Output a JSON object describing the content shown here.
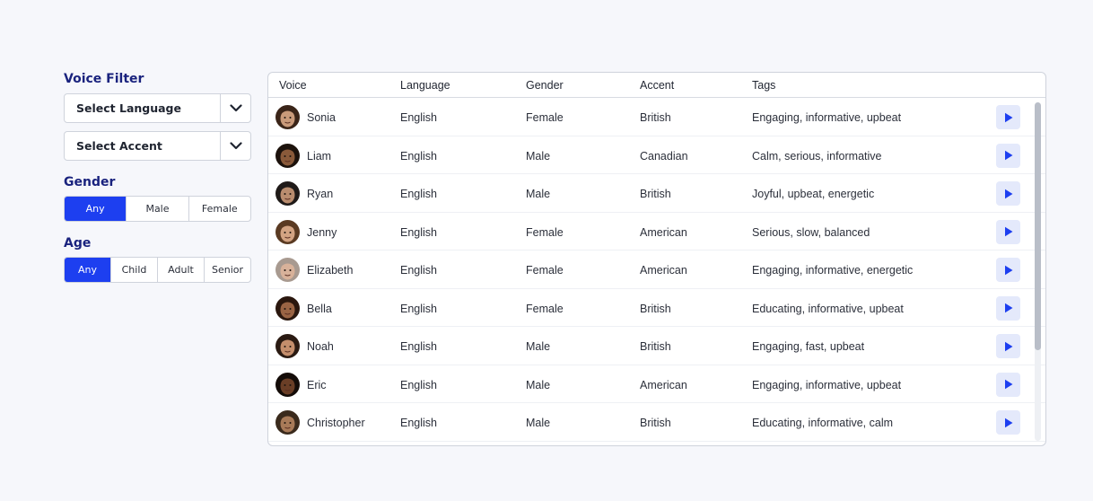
{
  "filters": {
    "voice_title": "Voice Filter",
    "language_select": "Select Language",
    "accent_select": "Select Accent",
    "gender_title": "Gender",
    "gender_options": [
      "Any",
      "Male",
      "Female"
    ],
    "gender_selected": "Any",
    "age_title": "Age",
    "age_options": [
      "Any",
      "Child",
      "Adult",
      "Senior"
    ],
    "age_selected": "Any"
  },
  "table": {
    "columns": [
      "Voice",
      "Language",
      "Gender",
      "Accent",
      "Tags"
    ],
    "rows": [
      {
        "voice": "Sonia",
        "language": "English",
        "gender": "Female",
        "accent": "British",
        "tags": "Engaging, informative, upbeat",
        "skin": "#c99a7a",
        "hair": "#3a2418"
      },
      {
        "voice": "Liam",
        "language": "English",
        "gender": "Male",
        "accent": "Canadian",
        "tags": "Calm, serious, informative",
        "skin": "#8a5a3a",
        "hair": "#1c120c"
      },
      {
        "voice": "Ryan",
        "language": "English",
        "gender": "Male",
        "accent": "British",
        "tags": "Joyful, upbeat, energetic",
        "skin": "#b98c6e",
        "hair": "#1f1a18"
      },
      {
        "voice": "Jenny",
        "language": "English",
        "gender": "Female",
        "accent": "American",
        "tags": "Serious, slow, balanced",
        "skin": "#d3a382",
        "hair": "#5a3a22"
      },
      {
        "voice": "Elizabeth",
        "language": "English",
        "gender": "Female",
        "accent": "American",
        "tags": "Engaging, informative, energetic",
        "skin": "#d8b29a",
        "hair": "#a89a90"
      },
      {
        "voice": "Bella",
        "language": "English",
        "gender": "Female",
        "accent": "British",
        "tags": "Educating, informative, upbeat",
        "skin": "#9a6444",
        "hair": "#2a170e"
      },
      {
        "voice": "Noah",
        "language": "English",
        "gender": "Male",
        "accent": "British",
        "tags": "Engaging, fast, upbeat",
        "skin": "#c48e6c",
        "hair": "#2a1a12"
      },
      {
        "voice": "Eric",
        "language": "English",
        "gender": "Male",
        "accent": "American",
        "tags": "Engaging, informative, upbeat",
        "skin": "#6a3e26",
        "hair": "#140c08"
      },
      {
        "voice": "Christopher",
        "language": "English",
        "gender": "Male",
        "accent": "British",
        "tags": "Educating, informative, calm",
        "skin": "#a87a58",
        "hair": "#3a2a1c"
      }
    ]
  },
  "colors": {
    "accent": "#1d3ff0",
    "title": "#1a237e",
    "play_bg": "#e4e9fb"
  },
  "icons": {
    "select_toggle": "chevron-down-icon",
    "play": "play-icon"
  }
}
